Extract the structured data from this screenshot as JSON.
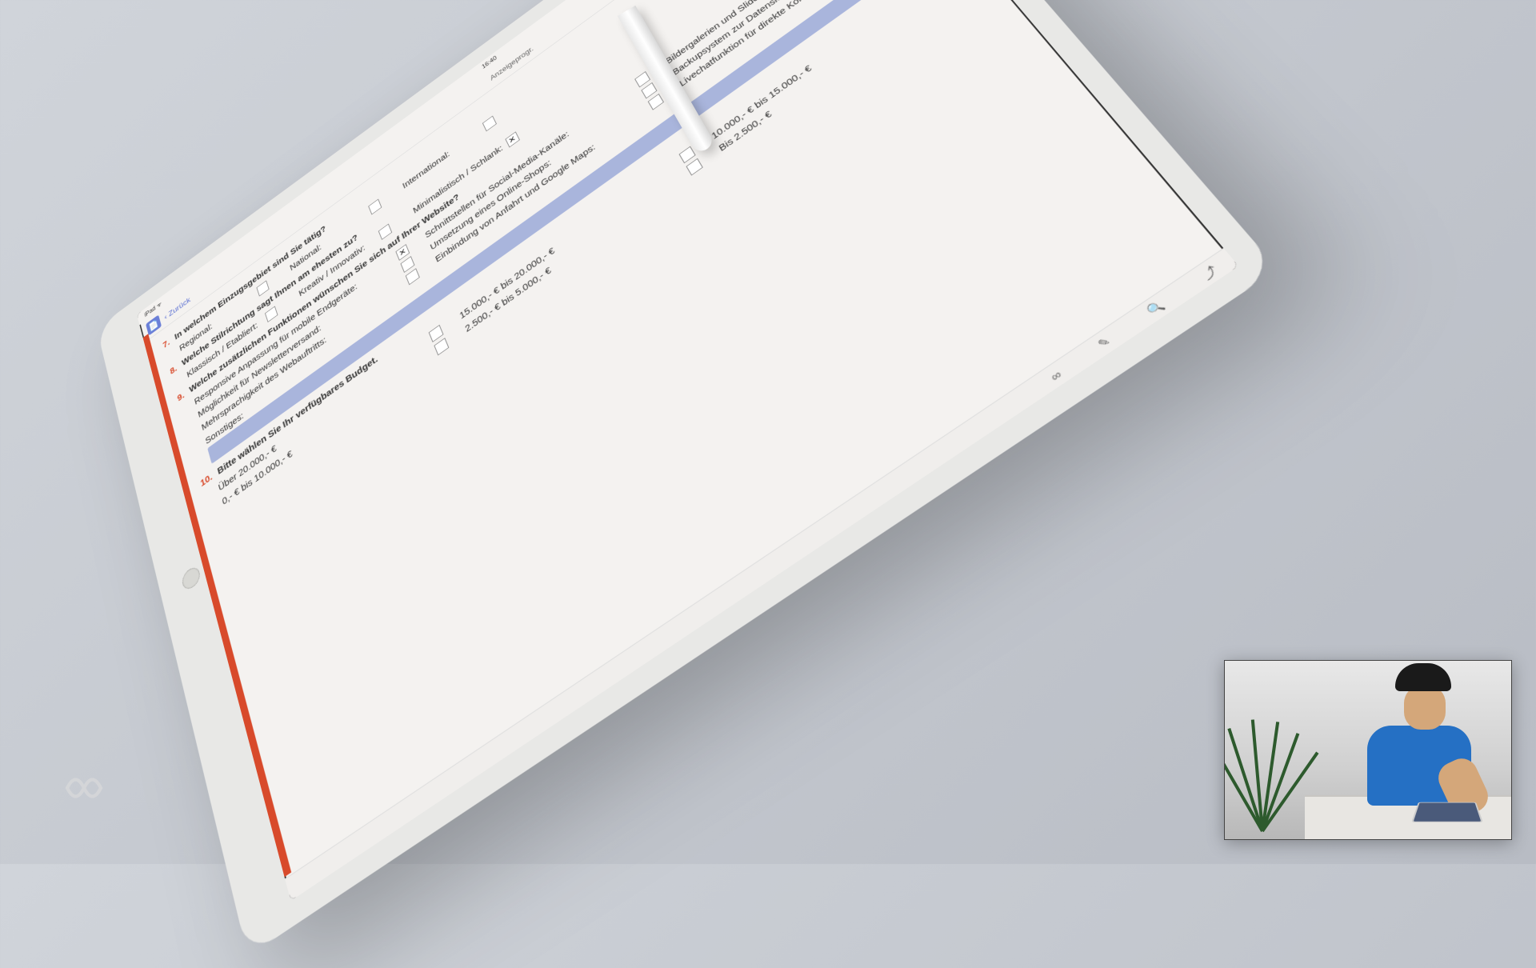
{
  "topbar": {
    "left": "iPad ᯤ",
    "time": "16:40",
    "right": ""
  },
  "nav": {
    "back": "‹ Zurück",
    "title": "Anzeigeprogr."
  },
  "questions": {
    "q7": {
      "num": "7.",
      "text": "In welchem Einzugsgebiet sind Sie tätig?",
      "opts": [
        {
          "label": "Regional:",
          "checked": false
        },
        {
          "label": "National:",
          "checked": false
        },
        {
          "label": "International:",
          "checked": false
        }
      ]
    },
    "q8": {
      "num": "8.",
      "text": "Welche Stilrichtung sagt Ihnen am ehesten zu?",
      "opts": [
        {
          "label": "Klassisch / Etabliert:",
          "checked": false
        },
        {
          "label": "Kreativ / Innovativ:",
          "checked": false
        },
        {
          "label": "Minimalistisch / Schlank:",
          "checked": true
        }
      ]
    },
    "q9": {
      "num": "9.",
      "text": "Welche zusätzlichen Funktionen wünschen Sie sich auf Ihrer Website?",
      "opts": [
        {
          "label": "Responsive Anpassung für mobile Endgeräte:",
          "checked": true
        },
        {
          "label": "Schnittstellen für Social-Media-Kanäle:",
          "checked": false
        },
        {
          "label": "Bildergalerien und Slideshows:",
          "checked": false
        },
        {
          "label": "Möglichkeit für Newsletterversand:",
          "checked": false
        },
        {
          "label": "Umsetzung eines Online-Shops:",
          "checked": false
        },
        {
          "label": "Backupsystem zur Datensicherung:",
          "checked": false
        },
        {
          "label": "Mehrsprachigkeit des Webauftritts:",
          "checked": false
        },
        {
          "label": "Einbindung von Anfahrt und Google Maps:",
          "checked": false
        },
        {
          "label": "Livechatfunktion für direkte Kontaktaufnahme:",
          "checked": false
        }
      ],
      "other": "Sonstiges:"
    },
    "q10": {
      "num": "10.",
      "text": "Bitte wählen Sie Ihr verfügbares Budget.",
      "opts": [
        {
          "label": "Über 20.000,- €",
          "checked": false
        },
        {
          "label": "15.000,- € bis 20.000,- €",
          "checked": false
        },
        {
          "label": "10.000,- € bis 15.000,- €",
          "checked": false
        },
        {
          "label": "0,- € bis 10.000,- €",
          "checked": false
        },
        {
          "label": "2.500,- € bis 5.000,- €",
          "checked": false
        },
        {
          "label": "Bis 2.500,- €",
          "checked": false
        }
      ]
    }
  },
  "bottombar": {
    "items": [
      "∞",
      "✎",
      "🔍",
      "⤴"
    ]
  }
}
